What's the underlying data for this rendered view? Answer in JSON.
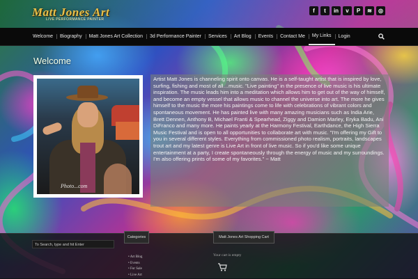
{
  "header": {
    "logo_text": "Matt Jones Art",
    "logo_sub": "LIVE PERFORMANCE PAINTER",
    "social_icons": [
      {
        "name": "facebook-icon",
        "glyph": "f"
      },
      {
        "name": "twitter-icon",
        "glyph": "t"
      },
      {
        "name": "linkedin-icon",
        "glyph": "in"
      },
      {
        "name": "vimeo-icon",
        "glyph": "v"
      },
      {
        "name": "pinterest-icon",
        "glyph": "P"
      },
      {
        "name": "rss-icon",
        "glyph": "≋"
      },
      {
        "name": "instagram-icon",
        "glyph": "◎"
      }
    ]
  },
  "nav": {
    "items": [
      {
        "label": "Welcome"
      },
      {
        "label": "Biography"
      },
      {
        "label": "Matt Jones Art Collection"
      },
      {
        "label": "3d Performance Painter"
      },
      {
        "label": "Services"
      },
      {
        "label": "Art Blog"
      },
      {
        "label": "Events"
      },
      {
        "label": "Contact Me"
      },
      {
        "label": "My Links"
      },
      {
        "label": "Login"
      }
    ],
    "active": "My Links"
  },
  "main": {
    "title": "Welcome",
    "photo_watermark": "Photo...com",
    "bio": "Artist Matt Jones is channeling spirit onto canvas. He is a self-taught artist that is inspired by love, surfing, fishing and most of all…music. \"Live painting\" in the presence of live music is his ultimate inspiration. The music leads him into a meditation which allows him to get out of the way of himself, and become an empty vessel that allows music to channel the universe into art. The more he gives himself to the music the more his paintings come to life with celebrations of vibrant colors and spontaneous movement. He has painted live with many amazing musicians such as India Arie, Brett Dennen, Anthony B, Michael Franti & Spearhead, Ziggy and Damion Marley, Eryka Badu, Ani DiFranco and many more. He paints yearly at the Harmony Festival, Earthdance, the High Sierra Music Festival and is open to all opportunities to collaborate art with music. \"I'm offering my Gift to you in several different styles. Everything from commissioned photo realism, portraits, landscapes trout art and my latest genre is Live Art in front of live music. So if you'd like some unique entertainment at a party, I create spontaneously through the energy of music and my surroundings. I'm also offering prints of some of my favorites.\" ~ Matt"
  },
  "footer": {
    "search_placeholder": "To Search, type and hit Enter",
    "categories_title": "Categories",
    "categories": [
      "Art Blog",
      "Events",
      "For Sale",
      "Live Art"
    ],
    "cart_title": "Matt Jones Art Shopping Cart",
    "cart_empty": "Your cart is empty"
  }
}
